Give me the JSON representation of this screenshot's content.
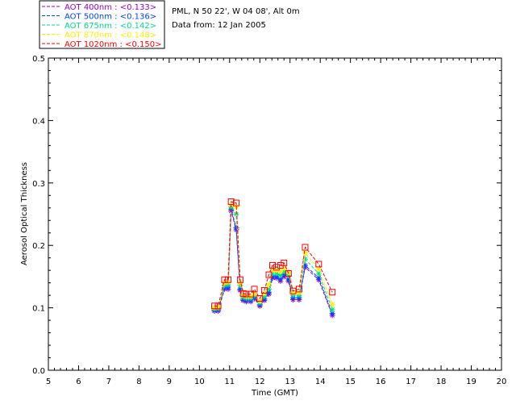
{
  "header": {
    "station": "PML, N 50 22', W 04 08', Alt 0m",
    "date_line": "Data from: 12 Jan 2005"
  },
  "chart_data": {
    "type": "line",
    "title": "",
    "xlabel": "Time (GMT)",
    "ylabel": "Aerosol Optical Thickness",
    "xlim": [
      5,
      20
    ],
    "ylim": [
      0.0,
      0.5
    ],
    "x_ticks": [
      "5",
      "6",
      "7",
      "8",
      "9",
      "10",
      "11",
      "12",
      "13",
      "14",
      "15",
      "16",
      "17",
      "18",
      "19",
      "20"
    ],
    "y_ticks": [
      "0.0",
      "0.1",
      "0.2",
      "0.3",
      "0.4",
      "0.5"
    ],
    "grid": false,
    "legend_position": "top-left, outside plot",
    "x": [
      10.5,
      10.62,
      10.83,
      10.95,
      11.05,
      11.22,
      11.35,
      11.45,
      11.55,
      11.7,
      11.82,
      12.0,
      12.15,
      12.3,
      12.42,
      12.55,
      12.68,
      12.8,
      12.95,
      13.1,
      13.3,
      13.5,
      13.95,
      14.4
    ],
    "series": [
      {
        "name": "AOT  400nm : <0.133>",
        "color": "#9900cc",
        "marker": "star",
        "values": [
          0.095,
          0.095,
          0.13,
          0.13,
          0.255,
          0.225,
          0.128,
          0.112,
          0.11,
          0.11,
          0.115,
          0.103,
          0.112,
          0.122,
          0.148,
          0.148,
          0.143,
          0.15,
          0.143,
          0.113,
          0.113,
          0.165,
          0.145,
          0.088
        ]
      },
      {
        "name": "AOT  500nm : <0.136>",
        "color": "#0044ff",
        "marker": "star",
        "values": [
          0.096,
          0.097,
          0.132,
          0.133,
          0.258,
          0.228,
          0.13,
          0.114,
          0.112,
          0.112,
          0.117,
          0.105,
          0.114,
          0.125,
          0.15,
          0.15,
          0.146,
          0.153,
          0.146,
          0.116,
          0.116,
          0.168,
          0.148,
          0.091
        ]
      },
      {
        "name": "AOT  675nm : <0.142>",
        "color": "#00dd88",
        "marker": "star",
        "values": [
          0.098,
          0.099,
          0.136,
          0.137,
          0.262,
          0.25,
          0.136,
          0.117,
          0.115,
          0.115,
          0.12,
          0.108,
          0.118,
          0.13,
          0.155,
          0.155,
          0.152,
          0.158,
          0.152,
          0.12,
          0.12,
          0.178,
          0.155,
          0.097
        ]
      },
      {
        "name": "AOT  870nm : <0.148>",
        "color": "#ffee00",
        "marker": "star",
        "values": [
          0.1,
          0.101,
          0.14,
          0.141,
          0.265,
          0.262,
          0.14,
          0.12,
          0.118,
          0.118,
          0.123,
          0.11,
          0.123,
          0.137,
          0.16,
          0.16,
          0.158,
          0.163,
          0.157,
          0.124,
          0.124,
          0.188,
          0.162,
          0.105
        ]
      },
      {
        "name": "AOT 1020nm : <0.150>",
        "color": "#ff0000",
        "marker": "square",
        "values": [
          0.103,
          0.103,
          0.145,
          0.145,
          0.27,
          0.268,
          0.145,
          0.123,
          0.122,
          0.122,
          0.13,
          0.115,
          0.128,
          0.153,
          0.168,
          0.165,
          0.168,
          0.172,
          0.155,
          0.127,
          0.13,
          0.197,
          0.17,
          0.125
        ]
      }
    ]
  }
}
